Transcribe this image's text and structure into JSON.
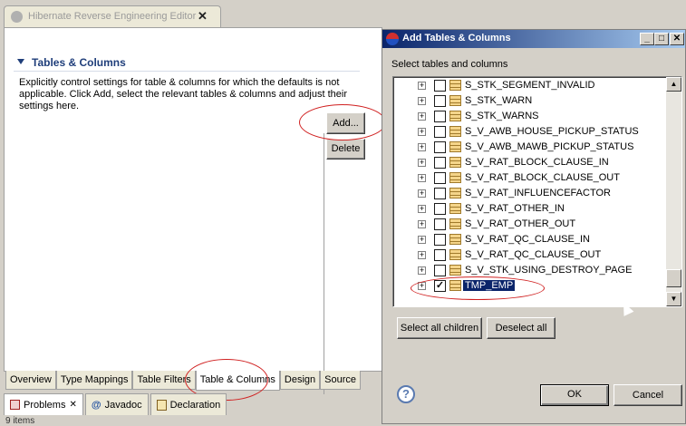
{
  "editor": {
    "tab_title": "Hibernate Reverse Engineering Editor",
    "section_title": "Tables & Columns",
    "description": "Explicitly control settings for table & columns for which the defaults is not applicable. Click Add, select the relevant tables & columns and adjust their settings here.",
    "add_label": "Add...",
    "delete_label": "Delete",
    "bottom_tabs": [
      "Overview",
      "Type Mappings",
      "Table Filters",
      "Table & Columns",
      "Design",
      "Source"
    ],
    "active_tab": "Table & Columns"
  },
  "views": {
    "tabs": [
      {
        "label": "Problems",
        "icon": "problems-icon"
      },
      {
        "label": "Javadoc",
        "icon": "at-icon"
      },
      {
        "label": "Declaration",
        "icon": "declaration-icon"
      }
    ],
    "status": "9 items"
  },
  "dialog": {
    "title": "Add Tables & Columns",
    "label": "Select tables and columns",
    "tables": [
      {
        "name": "S_STK_SEGMENT_INVALID",
        "checked": false
      },
      {
        "name": "S_STK_WARN",
        "checked": false
      },
      {
        "name": "S_STK_WARNS",
        "checked": false
      },
      {
        "name": "S_V_AWB_HOUSE_PICKUP_STATUS",
        "checked": false
      },
      {
        "name": "S_V_AWB_MAWB_PICKUP_STATUS",
        "checked": false
      },
      {
        "name": "S_V_RAT_BLOCK_CLAUSE_IN",
        "checked": false
      },
      {
        "name": "S_V_RAT_BLOCK_CLAUSE_OUT",
        "checked": false
      },
      {
        "name": "S_V_RAT_INFLUENCEFACTOR",
        "checked": false
      },
      {
        "name": "S_V_RAT_OTHER_IN",
        "checked": false
      },
      {
        "name": "S_V_RAT_OTHER_OUT",
        "checked": false
      },
      {
        "name": "S_V_RAT_QC_CLAUSE_IN",
        "checked": false
      },
      {
        "name": "S_V_RAT_QC_CLAUSE_OUT",
        "checked": false
      },
      {
        "name": "S_V_STK_USING_DESTROY_PAGE",
        "checked": false
      },
      {
        "name": "TMP_EMP",
        "checked": true,
        "selected": true
      }
    ],
    "select_all_label": "Select all children",
    "deselect_all_label": "Deselect all",
    "help_label": "?",
    "ok_label": "OK",
    "cancel_label": "Cancel"
  },
  "colors": {
    "title_bar": "#0a246a",
    "highlight_ring": "#d02020",
    "section_title": "#1f3e7a"
  }
}
